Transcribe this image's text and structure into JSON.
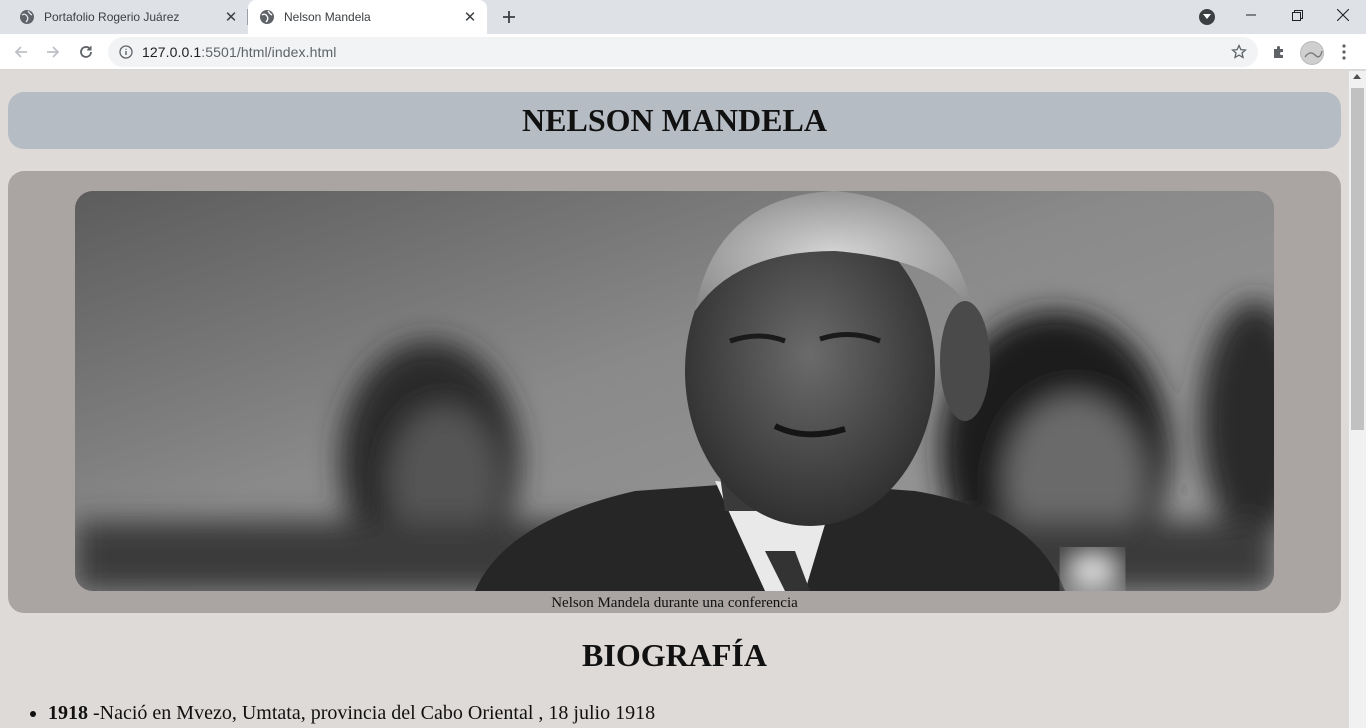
{
  "browser": {
    "tabs": [
      {
        "title": "Portafolio Rogerio Juárez",
        "active": false
      },
      {
        "title": "Nelson Mandela",
        "active": true
      }
    ],
    "url_host": "127.0.0.1",
    "url_rest": ":5501/html/index.html"
  },
  "page": {
    "header_title": "NELSON MANDELA",
    "figure": {
      "image_subject": "Black and white portrait of Nelson Mandela at a conference",
      "caption": "Nelson Mandela durante una conferencia"
    },
    "bio_title": "BIOGRAFÍA",
    "bio_items": [
      {
        "year": "1918",
        "text": " -Nació en Mvezo, Umtata, provincia del Cabo Oriental , 18 julio 1918"
      }
    ]
  },
  "colors": {
    "page_bg": "#dedad8",
    "header_bg": "#b5bcc3",
    "figure_bg": "#aaa5a3"
  }
}
